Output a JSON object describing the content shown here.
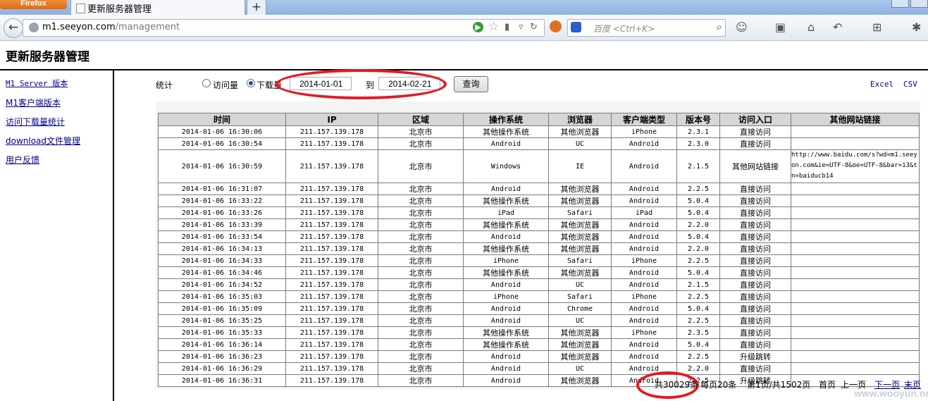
{
  "browser": {
    "app_button": "Firefox",
    "tab_title": "更新服务器管理",
    "new_tab": "+",
    "url_host": "m1.seeyon.com",
    "url_path": "/management",
    "search_placeholder": "百度 <Ctrl+K>"
  },
  "page": {
    "title": "更新服务器管理"
  },
  "sidebar": {
    "items": [
      {
        "label": "M1 Server 版本"
      },
      {
        "label": "M1客户端版本"
      },
      {
        "label": "访问下载量统计"
      },
      {
        "label": "download文件管理"
      },
      {
        "label": "用户反馈"
      }
    ]
  },
  "filters": {
    "stat_label": "统计",
    "radio_visits": "访问量",
    "radio_downloads": "下载量",
    "selected": "下载量",
    "date_from": "2014-01-01",
    "to_label": "到",
    "date_to": "2014-02-21",
    "query_button": "查询",
    "export_excel": "Excel",
    "export_csv": "CSV"
  },
  "table": {
    "columns": [
      "时间",
      "IP",
      "区域",
      "操作系统",
      "浏览器",
      "客户端类型",
      "版本号",
      "访问入口",
      "其他网站链接"
    ],
    "rows": [
      [
        "2014-01-06 16:30:06",
        "211.157.139.178",
        "北京市",
        "其他操作系统",
        "其他浏览器",
        "iPhone",
        "2.3.1",
        "直接访问",
        ""
      ],
      [
        "2014-01-06 16:30:54",
        "211.157.139.178",
        "北京市",
        "Android",
        "UC",
        "Android",
        "2.3.0",
        "直接访问",
        ""
      ],
      [
        "2014-01-06 16:30:59",
        "211.157.139.178",
        "北京市",
        "Windows",
        "IE",
        "Android",
        "2.1.5",
        "其他网站链接",
        "http://www.baidu.com/s?wd=m1.seeyon.com&ie=UTF-8&oe=UTF-8&bar=13&tn=baiducb14"
      ],
      [
        "2014-01-06 16:31:07",
        "211.157.139.178",
        "北京市",
        "Android",
        "其他浏览器",
        "Android",
        "2.2.5",
        "直接访问",
        ""
      ],
      [
        "2014-01-06 16:33:22",
        "211.157.139.178",
        "北京市",
        "其他操作系统",
        "其他浏览器",
        "Android",
        "5.0.4",
        "直接访问",
        ""
      ],
      [
        "2014-01-06 16:33:26",
        "211.157.139.178",
        "北京市",
        "iPad",
        "Safari",
        "iPad",
        "5.0.4",
        "直接访问",
        ""
      ],
      [
        "2014-01-06 16:33:39",
        "211.157.139.178",
        "北京市",
        "其他操作系统",
        "其他浏览器",
        "Android",
        "2.2.0",
        "直接访问",
        ""
      ],
      [
        "2014-01-06 16:33:54",
        "211.157.139.178",
        "北京市",
        "Android",
        "其他浏览器",
        "Android",
        "5.0.4",
        "直接访问",
        ""
      ],
      [
        "2014-01-06 16:34:13",
        "211.157.139.178",
        "北京市",
        "其他操作系统",
        "其他浏览器",
        "Android",
        "2.2.0",
        "直接访问",
        ""
      ],
      [
        "2014-01-06 16:34:33",
        "211.157.139.178",
        "北京市",
        "iPhone",
        "Safari",
        "iPhone",
        "2.2.5",
        "直接访问",
        ""
      ],
      [
        "2014-01-06 16:34:46",
        "211.157.139.178",
        "北京市",
        "其他操作系统",
        "其他浏览器",
        "Android",
        "5.0.4",
        "直接访问",
        ""
      ],
      [
        "2014-01-06 16:34:52",
        "211.157.139.178",
        "北京市",
        "Android",
        "UC",
        "Android",
        "2.1.5",
        "直接访问",
        ""
      ],
      [
        "2014-01-06 16:35:03",
        "211.157.139.178",
        "北京市",
        "iPhone",
        "Safari",
        "iPhone",
        "2.2.5",
        "直接访问",
        ""
      ],
      [
        "2014-01-06 16:35:09",
        "211.157.139.178",
        "北京市",
        "Android",
        "Chrome",
        "Android",
        "5.0.4",
        "直接访问",
        ""
      ],
      [
        "2014-01-06 16:35:25",
        "211.157.139.178",
        "北京市",
        "Android",
        "UC",
        "Android",
        "2.2.5",
        "直接访问",
        ""
      ],
      [
        "2014-01-06 16:35:33",
        "211.157.139.178",
        "北京市",
        "其他操作系统",
        "其他浏览器",
        "iPhone",
        "2.3.5",
        "直接访问",
        ""
      ],
      [
        "2014-01-06 16:36:14",
        "211.157.139.178",
        "北京市",
        "其他操作系统",
        "其他浏览器",
        "Android",
        "5.0.4",
        "直接访问",
        ""
      ],
      [
        "2014-01-06 16:36:23",
        "211.157.139.178",
        "北京市",
        "Android",
        "其他浏览器",
        "Android",
        "2.2.5",
        "升级跳转",
        ""
      ],
      [
        "2014-01-06 16:36:29",
        "211.157.139.178",
        "北京市",
        "Android",
        "UC",
        "Android",
        "2.2.0",
        "直接访问",
        ""
      ],
      [
        "2014-01-06 16:36:31",
        "211.157.139.178",
        "北京市",
        "Android",
        "其他浏览器",
        "Android",
        "2.2.5",
        "升级跳转",
        ""
      ]
    ]
  },
  "pager": {
    "total": "共30029条",
    "per_page": "每页20条",
    "page_info": "第1页/共1502页",
    "first": "首页",
    "prev": "上一页",
    "next": "下一页",
    "last": "末页"
  },
  "watermark": "www.wooyun.org",
  "colors": {
    "annotation_red": "#e21b23",
    "link": "#00008b",
    "header_gray": "#d6d6d6"
  },
  "icons": [
    "back-icon",
    "globe-icon",
    "go-icon",
    "bookmark-star-icon",
    "stop-icon",
    "baidu-paw-icon",
    "search-icon",
    "home-icon",
    "undo-icon",
    "crop-icon"
  ]
}
